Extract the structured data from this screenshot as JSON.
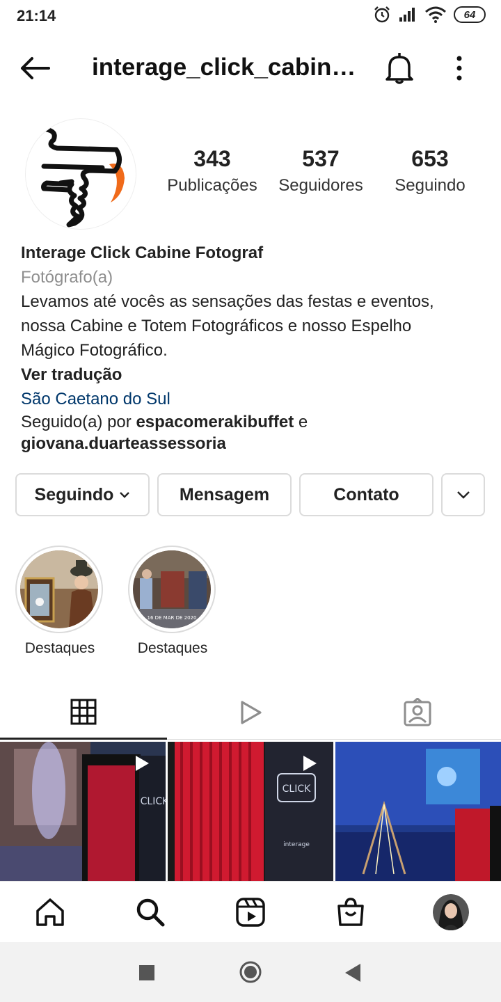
{
  "status_bar": {
    "time": "21:14",
    "battery": "64"
  },
  "header": {
    "title": "interage_click_cabin…"
  },
  "profile": {
    "stats": [
      {
        "value": "343",
        "label": "Publicações"
      },
      {
        "value": "537",
        "label": "Seguidores"
      },
      {
        "value": "653",
        "label": "Seguindo"
      }
    ],
    "name": "Interage Click Cabine Fotograf",
    "category": "Fotógrafo(a)",
    "bio_lines": [
      "Levamos até vocês as sensações das festas e eventos,",
      "nossa Cabine e Totem Fotográficos e nosso Espelho",
      "Mágico Fotográfico."
    ],
    "translate_label": "Ver tradução",
    "location": "São Caetano do Sul",
    "followed_by_prefix": "Seguido(a) por ",
    "followed_by_user1": "espacomerakibuffet",
    "followed_by_and": " e",
    "followed_by_user2": "giovana.duarteassessoria"
  },
  "actions": {
    "following_label": "Seguindo",
    "message_label": "Mensagem",
    "contact_label": "Contato"
  },
  "highlights": [
    {
      "label": "Destaques"
    },
    {
      "label": "Destaques",
      "date_text": "16 DE MAR DE 2020"
    }
  ],
  "tabs": [
    "grid-icon",
    "reels-icon",
    "tagged-icon"
  ],
  "grid_overlay_text": {
    "brand": "CLICK",
    "brand_small": "interage"
  },
  "bottom_nav": [
    "home-icon",
    "search-icon",
    "reels-icon",
    "shop-icon",
    "profile-avatar"
  ],
  "system_nav": [
    "square-icon",
    "circle-icon",
    "back-triangle-icon"
  ]
}
